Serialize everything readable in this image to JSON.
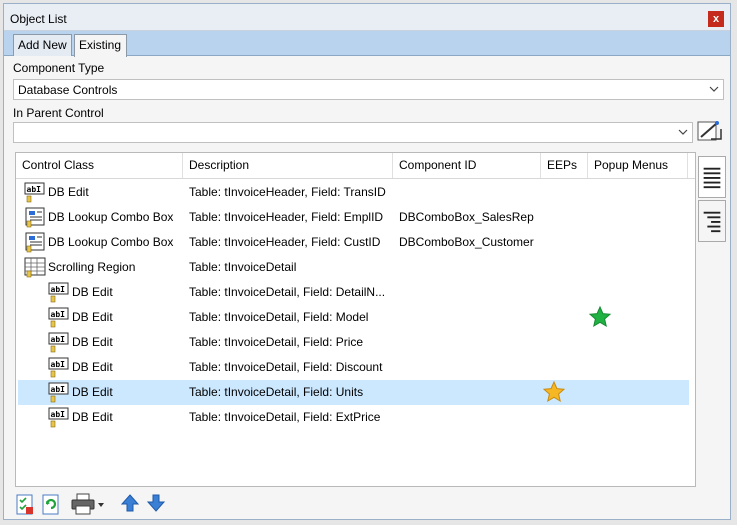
{
  "window": {
    "title": "Object List",
    "close_glyph": "x"
  },
  "tabs": [
    {
      "label": "Add New",
      "active": false
    },
    {
      "label": "Existing",
      "active": true
    }
  ],
  "component_type": {
    "label": "Component Type",
    "value": "Database Controls"
  },
  "parent_control": {
    "label": "In Parent Control",
    "value": ""
  },
  "grid": {
    "columns": [
      "Control Class",
      "Description",
      "Component ID",
      "EEPs",
      "Popup Menus"
    ],
    "rows": [
      {
        "icon": "db-edit-icon",
        "indent": 0,
        "control_class": "DB Edit",
        "description": "Table: tInvoiceHeader, Field: TransID",
        "component_id": "",
        "eeps": "",
        "popup": "",
        "selected": false
      },
      {
        "icon": "db-lookup-combo-icon",
        "indent": 0,
        "control_class": "DB Lookup Combo Box",
        "description": "Table: tInvoiceHeader, Field: EmplID",
        "component_id": "DBComboBox_SalesRep",
        "eeps": "",
        "popup": "",
        "selected": false
      },
      {
        "icon": "db-lookup-combo-icon",
        "indent": 0,
        "control_class": "DB Lookup Combo Box",
        "description": "Table: tInvoiceHeader, Field: CustID",
        "component_id": "DBComboBox_Customer",
        "eeps": "",
        "popup": "",
        "selected": false
      },
      {
        "icon": "scrolling-region-icon",
        "indent": 0,
        "control_class": "Scrolling Region",
        "description": "Table: tInvoiceDetail",
        "component_id": "",
        "eeps": "",
        "popup": "",
        "selected": false
      },
      {
        "icon": "db-edit-icon",
        "indent": 1,
        "control_class": "DB Edit",
        "description": "Table: tInvoiceDetail, Field: DetailN...",
        "component_id": "",
        "eeps": "",
        "popup": "",
        "selected": false
      },
      {
        "icon": "db-edit-icon",
        "indent": 1,
        "control_class": "DB Edit",
        "description": "Table: tInvoiceDetail, Field: Model",
        "component_id": "",
        "eeps": "",
        "popup": "green-star",
        "selected": false
      },
      {
        "icon": "db-edit-icon",
        "indent": 1,
        "control_class": "DB Edit",
        "description": "Table: tInvoiceDetail, Field: Price",
        "component_id": "",
        "eeps": "",
        "popup": "",
        "selected": false
      },
      {
        "icon": "db-edit-icon",
        "indent": 1,
        "control_class": "DB Edit",
        "description": "Table: tInvoiceDetail, Field: Discount",
        "component_id": "",
        "eeps": "",
        "popup": "",
        "selected": false
      },
      {
        "icon": "db-edit-icon",
        "indent": 1,
        "control_class": "DB Edit",
        "description": "Table: tInvoiceDetail, Field: Units",
        "component_id": "",
        "eeps": "gold-star",
        "popup": "",
        "selected": true
      },
      {
        "icon": "db-edit-icon",
        "indent": 1,
        "control_class": "DB Edit",
        "description": "Table: tInvoiceDetail, Field: ExtPrice",
        "component_id": "",
        "eeps": "",
        "popup": "",
        "selected": false
      }
    ]
  },
  "colors": {
    "accent": "#b9d3ee",
    "selected_row": "#cce8ff",
    "close": "#c42b1c",
    "green_star": "#1fb141",
    "gold_star": "#f6b724"
  },
  "toolbar_icons": [
    "checklist-icon",
    "refresh-icon",
    "print-icon",
    "move-up-icon",
    "move-down-icon"
  ]
}
